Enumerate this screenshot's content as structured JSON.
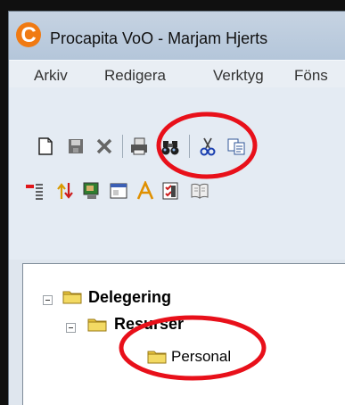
{
  "window": {
    "title": "Procapita VoO - Marjam Hjerts",
    "app_icon_letter": "C"
  },
  "menu": {
    "items": [
      "Arkiv",
      "Redigera",
      "Verktyg",
      "Föns"
    ]
  },
  "toolbar_row1": {
    "icons": [
      "new-document-icon",
      "save-icon",
      "delete-icon",
      "print-icon",
      "binoculars-search-icon",
      "cut-icon",
      "copy-icon"
    ]
  },
  "toolbar_row2": {
    "icons": [
      "indent-list-icon",
      "arrows-icon",
      "monitor-icon",
      "window-icon",
      "font-a-icon",
      "checklist-icon",
      "book-icon"
    ]
  },
  "tree": {
    "nodes": [
      {
        "label": "Delegering",
        "bold": true,
        "expanded": true
      },
      {
        "label": "Resurser",
        "bold": true,
        "expanded": true
      },
      {
        "label": "Personal",
        "bold": false,
        "selected": true
      }
    ]
  },
  "annotations": {
    "circle_color": "#e8101a",
    "circled_items": [
      "binoculars-search-icon",
      "Personal"
    ]
  }
}
